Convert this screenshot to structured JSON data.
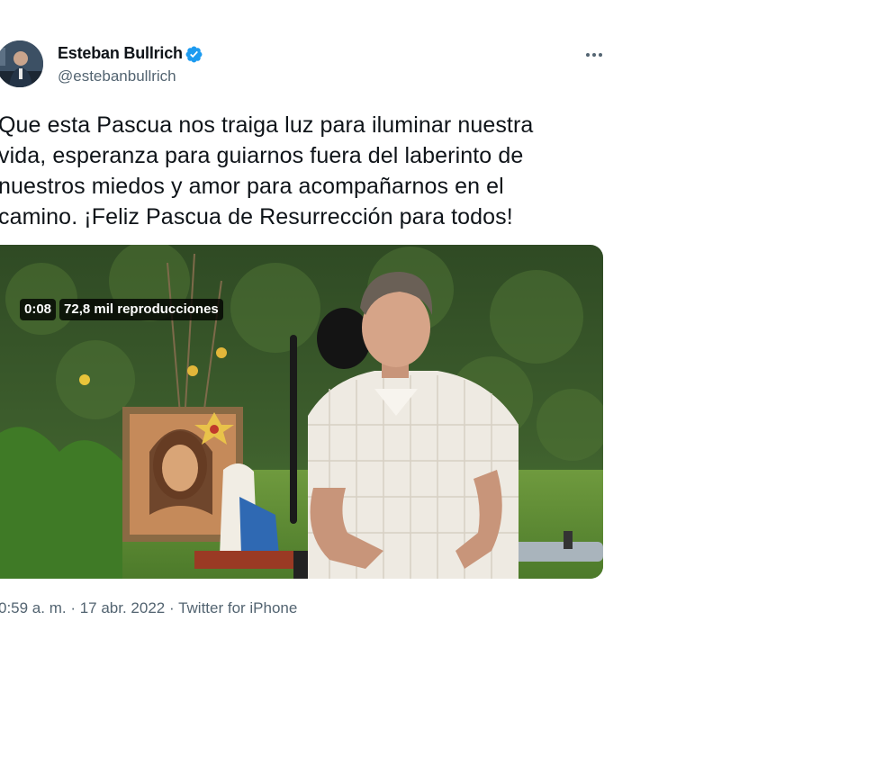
{
  "author": {
    "name": "Esteban Bullrich",
    "handle": "@estebanbullrich"
  },
  "icons": {
    "verified": "verified-badge-icon",
    "more": "more-options-icon"
  },
  "colors": {
    "verified_blue": "#1d9bf0",
    "secondary_text": "#536471"
  },
  "tweet": {
    "text_lines": [
      "Que esta Pascua nos traiga luz para iluminar nuestra",
      "vida, esperanza para guiarnos fuera del laberinto de",
      "nuestros miedos y amor para acompañarnos en el",
      "camino. ¡Feliz Pascua de Resurrección para todos!"
    ]
  },
  "media": {
    "duration": "0:08",
    "views": "72,8 mil reproducciones",
    "views_fraction_shown": 0
  },
  "meta": {
    "time": "0:59 a. m.",
    "sep1": " · ",
    "date": "17 abr. 2022",
    "sep2": " · ",
    "source": "Twitter for iPhone"
  }
}
